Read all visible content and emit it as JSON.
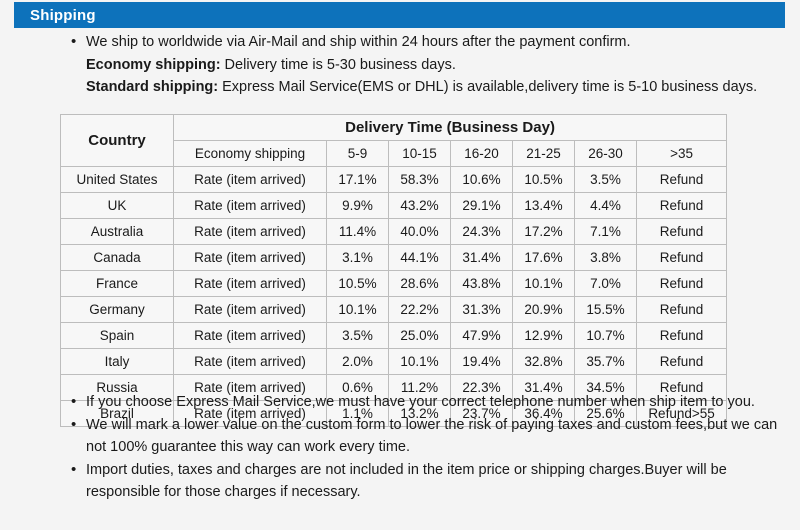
{
  "header": {
    "title": "Shipping",
    "accent_color": "#0d72bb",
    "text_color": "#ffffff"
  },
  "intro": {
    "bullet": "We ship to worldwide via Air-Mail and ship within 24 hours after the payment confirm.",
    "economy_label": "Economy shipping:",
    "economy_text": " Delivery time is 5-30 business days.",
    "standard_label": "Standard shipping:",
    "standard_text": " Express Mail Service(EMS or DHL) is available,delivery time is 5-10 business days."
  },
  "table": {
    "country_header": "Country",
    "delivery_header": "Delivery Time (Business Day)",
    "sub_headers": [
      "Economy shipping",
      "5-9",
      "10-15",
      "16-20",
      "21-25",
      "26-30",
      ">35"
    ],
    "rows": [
      {
        "country": "United States",
        "method": "Rate (item arrived)",
        "values": [
          "17.1%",
          "58.3%",
          "10.6%",
          "10.5%",
          "3.5%",
          "Refund"
        ]
      },
      {
        "country": "UK",
        "method": "Rate (item arrived)",
        "values": [
          "9.9%",
          "43.2%",
          "29.1%",
          "13.4%",
          "4.4%",
          "Refund"
        ]
      },
      {
        "country": "Australia",
        "method": "Rate (item arrived)",
        "values": [
          "11.4%",
          "40.0%",
          "24.3%",
          "17.2%",
          "7.1%",
          "Refund"
        ]
      },
      {
        "country": "Canada",
        "method": "Rate (item arrived)",
        "values": [
          "3.1%",
          "44.1%",
          "31.4%",
          "17.6%",
          "3.8%",
          "Refund"
        ]
      },
      {
        "country": "France",
        "method": "Rate (item arrived)",
        "values": [
          "10.5%",
          "28.6%",
          "43.8%",
          "10.1%",
          "7.0%",
          "Refund"
        ]
      },
      {
        "country": "Germany",
        "method": "Rate (item arrived)",
        "values": [
          "10.1%",
          "22.2%",
          "31.3%",
          "20.9%",
          "15.5%",
          "Refund"
        ]
      },
      {
        "country": "Spain",
        "method": "Rate (item arrived)",
        "values": [
          "3.5%",
          "25.0%",
          "47.9%",
          "12.9%",
          "10.7%",
          "Refund"
        ]
      },
      {
        "country": "Italy",
        "method": "Rate (item arrived)",
        "values": [
          "2.0%",
          "10.1%",
          "19.4%",
          "32.8%",
          "35.7%",
          "Refund"
        ]
      },
      {
        "country": "Russia",
        "method": "Rate (item arrived)",
        "values": [
          "0.6%",
          "11.2%",
          "22.3%",
          "31.4%",
          "34.5%",
          "Refund"
        ]
      },
      {
        "country": "Brazil",
        "method": "Rate (item arrived)",
        "values": [
          "1.1%",
          "13.2%",
          "23.7%",
          "36.4%",
          "25.6%",
          "Refund>55"
        ]
      }
    ]
  },
  "notes": [
    "If you choose Express Mail Service,we must have your correct telephone number when ship item to you.",
    "We will mark a lower value on the custom form to lower the risk of paying taxes and custom fees,but we can not 100% guarantee this way can work every time.",
    "Import duties, taxes and charges are not included in the item price or shipping charges.Buyer will be responsible for those charges if necessary."
  ]
}
